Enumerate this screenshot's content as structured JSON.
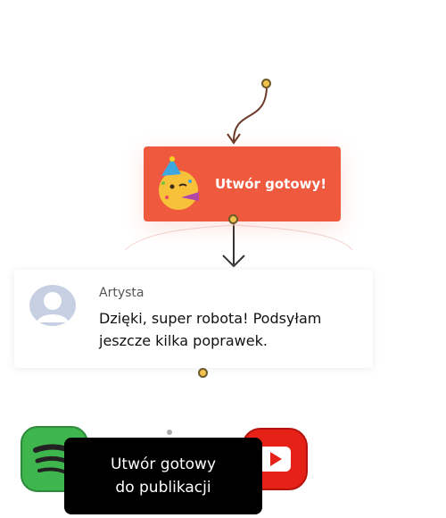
{
  "colors": {
    "accent": "#ef5a3f",
    "node": "#f2c14e",
    "connector": "#6b3a2a",
    "publish_bg": "#000000"
  },
  "flow": {
    "ready_card": {
      "emoji_icon": "party-face-icon",
      "label": "Utwór gotowy!"
    },
    "comment": {
      "author": "Artysta",
      "message": "Dzięki, super robota! Podsyłam jeszcze kilka poprawek."
    },
    "publish": {
      "line1": "Utwór gotowy",
      "line2": "do publikacji"
    },
    "apps": [
      "spotify-icon",
      "youtube-icon"
    ]
  }
}
